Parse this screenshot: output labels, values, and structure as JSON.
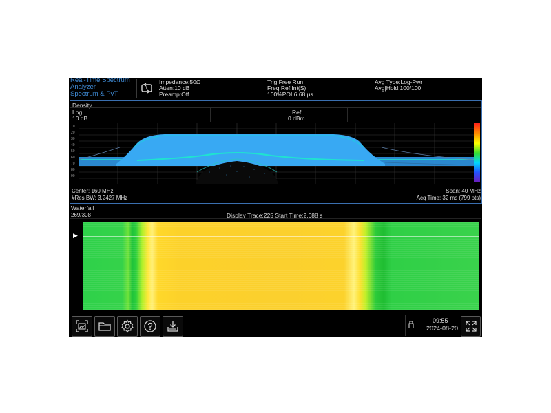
{
  "mode": {
    "line1": "Real-Time Spectrum",
    "line2": "Analyzer",
    "line3": "Spectrum & PvT"
  },
  "status": {
    "impedance": "Impedance:50Ω",
    "atten": "Atten:10 dB",
    "preamp": "Preamp:Off",
    "trig": "Trig:Free Run",
    "freq_ref": "Freq Ref:Int(S)",
    "poi": "100%POI:6.68 µs",
    "avg_type": "Avg Type:Log-Pwr",
    "avg_hold": "Avg|Hold:100/100"
  },
  "density": {
    "title": "Density",
    "scale_type": "Log",
    "scale_div": "10 dB",
    "ref_label": "Ref",
    "ref_value": "0 dBm",
    "y_ticks": [
      "10",
      "20",
      "30",
      "40",
      "50",
      "60",
      "70",
      "80",
      "90"
    ],
    "center": "Center: 160 MHz",
    "res_bw": "#Res BW: 3.2427 MHz",
    "span": "Span: 40 MHz",
    "acq_time": "Acq Time: 32 ms (799 pts)"
  },
  "waterfall": {
    "title": "Waterfall",
    "count": "269/308",
    "info": "Display Trace:225  Start Time:2.688 s",
    "marker": "▶"
  },
  "clock": {
    "time": "09:55",
    "date": "2024-08-20"
  },
  "toolbar": {
    "icons": [
      "screenshot-icon",
      "folder-icon",
      "settings-icon",
      "help-icon",
      "download-icon",
      "usb-icon",
      "expand-icon"
    ]
  },
  "colors": {
    "accent_blue": "#3f8bd6",
    "density_fill": "#35a8f0",
    "waterfall_yellow": "#fcd12a",
    "waterfall_green": "#2ed14a"
  }
}
